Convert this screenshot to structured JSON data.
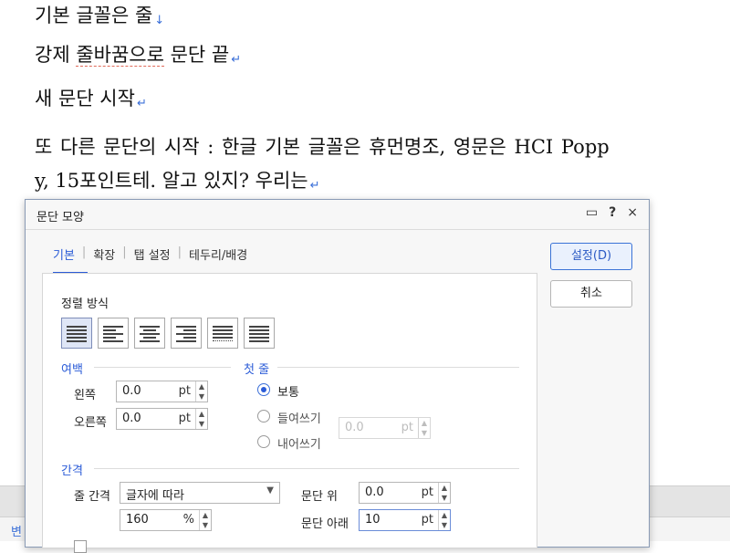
{
  "document": {
    "lines": [
      {
        "text": "기본 글꼴은 줄",
        "mark": "↓"
      },
      {
        "text_pre": "강제 ",
        "text_underlined": "줄바꿈으로",
        "text_post": " 문단 끝",
        "mark": "↵"
      },
      {
        "text": "새 문단 시작",
        "mark": "↵"
      },
      {
        "text": "또 다른 문단의 시작 : 한글 기본 글꼴은 휴먼명조, 영문은 HCI Popp"
      },
      {
        "text": "y, 15포인트테. 알고 있지? 우리는",
        "mark": "↵"
      }
    ],
    "bottom_tab_label": "변"
  },
  "dialog": {
    "title": "문단 모양",
    "controls": {
      "comment_icon": "▭",
      "help": "?",
      "close": "×"
    },
    "tabs": [
      "기본",
      "확장",
      "탭 설정",
      "테두리/배경"
    ],
    "active_tab": 0,
    "buttons": {
      "ok": "설정(D)",
      "cancel": "취소"
    },
    "alignment": {
      "label": "정렬 방식",
      "options": [
        "justify-icon",
        "left-align-icon",
        "center-align-icon",
        "right-align-icon",
        "distribute-icon",
        "divide-icon"
      ],
      "selected": 0
    },
    "margin": {
      "section": "여백",
      "left": {
        "label": "왼쪽",
        "value": "0.0",
        "unit": "pt"
      },
      "right": {
        "label": "오른쪽",
        "value": "0.0",
        "unit": "pt"
      }
    },
    "first_line": {
      "section": "첫 줄",
      "options": [
        "보통",
        "들여쓰기",
        "내어쓰기"
      ],
      "selected": 0,
      "value": "0.0",
      "unit": "pt"
    },
    "spacing": {
      "section": "간격",
      "line_spacing_label": "줄 간격",
      "line_spacing_type": "글자에 따라",
      "line_spacing_value": "160",
      "line_spacing_unit": "%",
      "para_above_label": "문단 위",
      "para_above_value": "0.0",
      "para_above_unit": "pt",
      "para_below_label": "문단 아래",
      "para_below_value": "10",
      "para_below_unit": "pt"
    }
  },
  "colors": {
    "accent": "#2a5bd7",
    "para_mark": "#3a6fd8",
    "spell_underline": "#e06a5a"
  }
}
